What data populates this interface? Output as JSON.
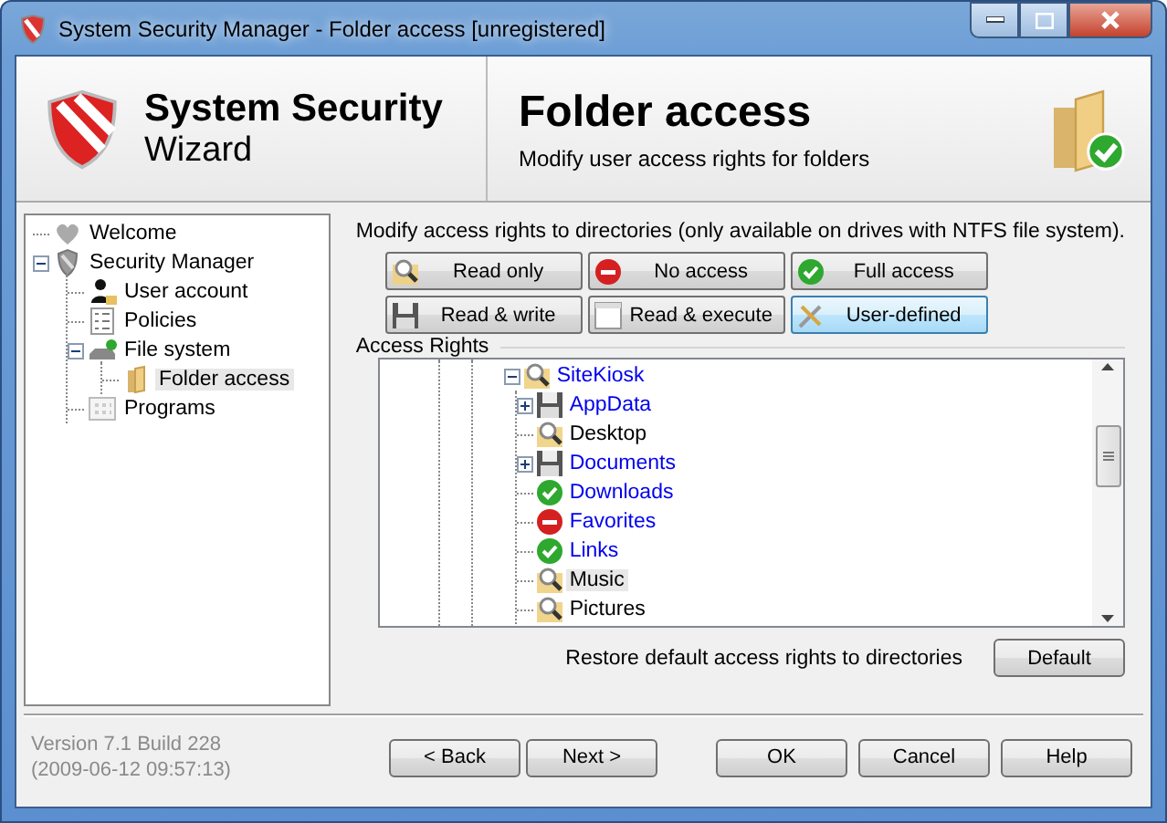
{
  "window": {
    "title": "System Security Manager - Folder access [unregistered]"
  },
  "header": {
    "product_title": "System Security",
    "product_subtitle": "Wizard",
    "page_title": "Folder access",
    "page_subtitle": "Modify user access rights for folders"
  },
  "nav_tree": [
    {
      "label": "Welcome",
      "kind": "heart",
      "selected": false
    },
    {
      "label": "Security Manager",
      "kind": "shield",
      "expanded": true,
      "selected": false,
      "children": [
        {
          "label": "User account",
          "kind": "user",
          "selected": false
        },
        {
          "label": "Policies",
          "kind": "list",
          "selected": false
        },
        {
          "label": "File system",
          "kind": "drive",
          "expanded": true,
          "selected": false,
          "children": [
            {
              "label": "Folder access",
              "kind": "folder",
              "selected": true
            }
          ]
        },
        {
          "label": "Programs",
          "kind": "grid",
          "selected": false
        }
      ]
    }
  ],
  "description": "Modify access rights to directories (only available on drives with NTFS file system).",
  "access_buttons": [
    {
      "label": "Read only",
      "kind": "read",
      "selected": false
    },
    {
      "label": "No access",
      "kind": "none",
      "selected": false
    },
    {
      "label": "Full access",
      "kind": "full",
      "selected": false
    },
    {
      "label": "Read & write",
      "kind": "write",
      "selected": false
    },
    {
      "label": "Read & execute",
      "kind": "execute",
      "selected": false
    },
    {
      "label": "User-defined",
      "kind": "custom",
      "selected": true
    }
  ],
  "access_rights": {
    "title": "Access Rights",
    "tree": [
      {
        "label": "SiteKiosk",
        "kind": "read",
        "customized": true,
        "expanded": true,
        "selected": false,
        "children": [
          {
            "label": "AppData",
            "kind": "write",
            "customized": true,
            "expanded": false,
            "selected": false
          },
          {
            "label": "Desktop",
            "kind": "read",
            "customized": false,
            "selected": false
          },
          {
            "label": "Documents",
            "kind": "write",
            "customized": true,
            "expanded": false,
            "selected": false
          },
          {
            "label": "Downloads",
            "kind": "full",
            "customized": true,
            "selected": false
          },
          {
            "label": "Favorites",
            "kind": "none",
            "customized": true,
            "selected": false
          },
          {
            "label": "Links",
            "kind": "full",
            "customized": true,
            "selected": false
          },
          {
            "label": "Music",
            "kind": "read",
            "customized": false,
            "selected": true
          },
          {
            "label": "Pictures",
            "kind": "read",
            "customized": false,
            "selected": false
          }
        ]
      }
    ]
  },
  "restore": {
    "label": "Restore default access rights to directories",
    "button": "Default"
  },
  "version": {
    "line_1": "Version 7.1 Build 228",
    "line_2": "(2009-06-12 09:57:13)"
  },
  "nav_buttons": [
    "< Back",
    "Next >"
  ],
  "action_buttons": [
    "OK",
    "Cancel",
    "Help"
  ]
}
